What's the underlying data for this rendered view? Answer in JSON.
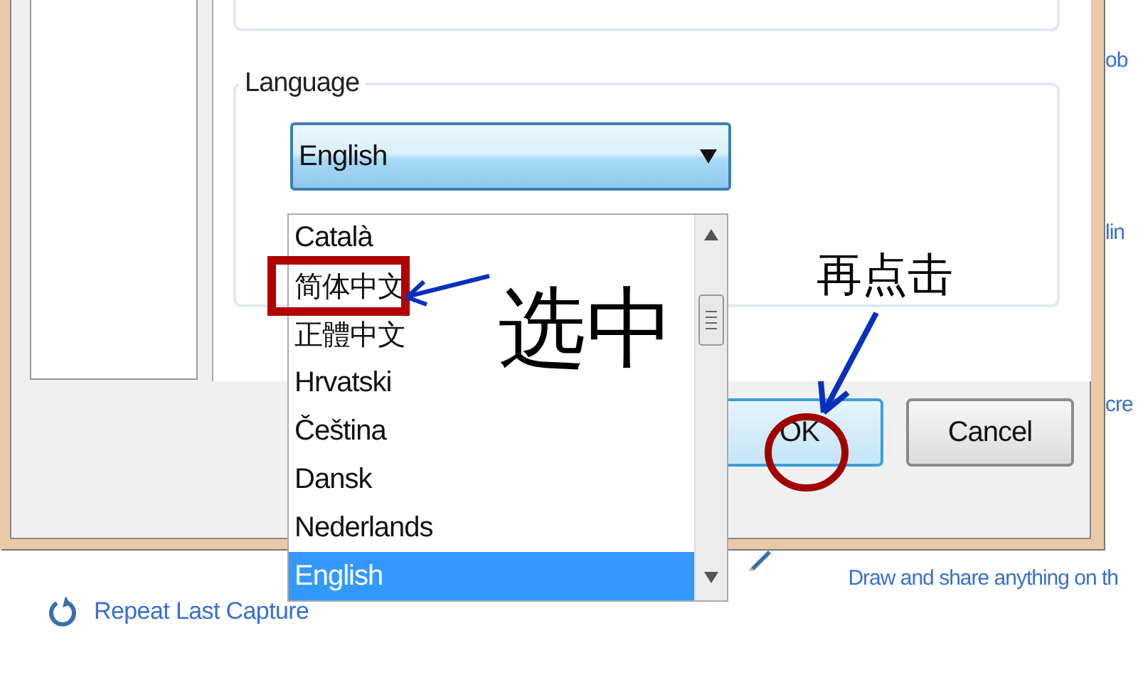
{
  "dialog": {
    "language_group": {
      "title": "Language",
      "combobox": {
        "value": "English"
      },
      "dropdown_items": [
        {
          "label": "Català",
          "selected": false
        },
        {
          "label": "简体中文",
          "selected": false
        },
        {
          "label": "正體中文",
          "selected": false
        },
        {
          "label": "Hrvatski",
          "selected": false
        },
        {
          "label": "Čeština",
          "selected": false
        },
        {
          "label": "Dansk",
          "selected": false
        },
        {
          "label": "Nederlands",
          "selected": false
        },
        {
          "label": "English",
          "selected": true
        }
      ]
    },
    "buttons": [
      {
        "label": "OK",
        "default": true
      },
      {
        "label": "Cancel",
        "default": false
      }
    ]
  },
  "background": {
    "right_edge_texts": [
      "ob",
      "lin",
      "cre"
    ],
    "repeat_link": "Repeat Last Capture",
    "draw_link": "Draw and share anything on th"
  },
  "annotations": {
    "select_label": "选中",
    "click_again_label": "再点击"
  }
}
